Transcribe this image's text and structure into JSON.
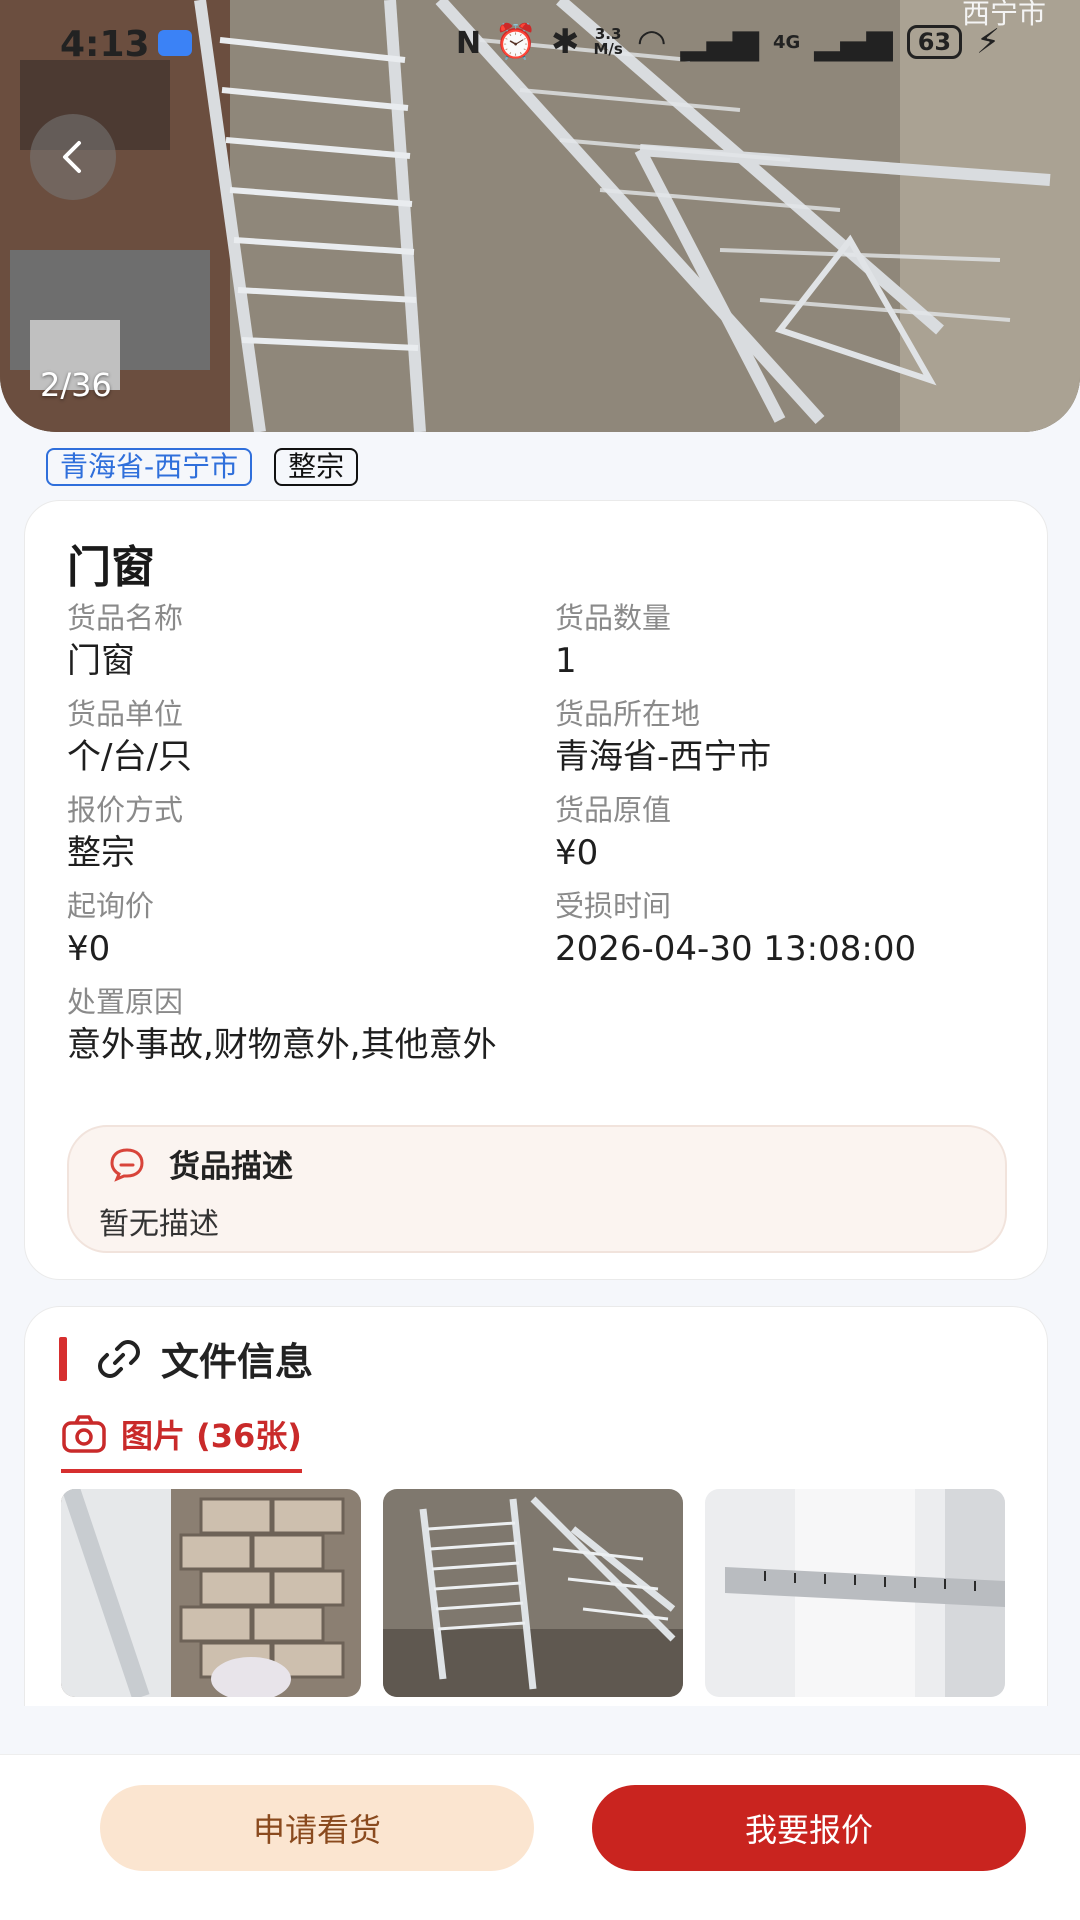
{
  "status_bar": {
    "time": "4:13",
    "speed_value": "3.3",
    "speed_unit": "M/s",
    "network": "4G",
    "battery": "63"
  },
  "hero": {
    "overlay_city": "西宁市",
    "counter": "2/36",
    "icons": {
      "back": "chevron-left-icon"
    }
  },
  "tags": [
    "青海省-西宁市",
    "整宗"
  ],
  "item": {
    "title": "门窗",
    "fields": [
      {
        "label": "货品名称",
        "value": "门窗"
      },
      {
        "label": "货品数量",
        "value": "1"
      },
      {
        "label": "货品单位",
        "value": "个/台/只"
      },
      {
        "label": "货品所在地",
        "value": "青海省-西宁市"
      },
      {
        "label": "报价方式",
        "value": "整宗"
      },
      {
        "label": "货品原值",
        "value": "¥0"
      },
      {
        "label": "起询价",
        "value": "¥0"
      },
      {
        "label": "受损时间",
        "value": "2026-04-30 13:08:00"
      },
      {
        "label": "处置原因",
        "value": "意外事故,财物意外,其他意外"
      }
    ],
    "description": {
      "title": "货品描述",
      "text": "暂无描述",
      "icon": "chat-bubble-icon"
    }
  },
  "files": {
    "title": "文件信息",
    "icon": "link-icon",
    "photos_tab": "图片 (36张)",
    "photos_icon": "camera-icon",
    "thumbnail_count": 3
  },
  "actions": {
    "view": "申请看货",
    "quote": "我要报价"
  },
  "colors": {
    "accent": "#c9241f",
    "tag_blue": "#2f6fdb",
    "view_button_bg": "#fbe5d0"
  }
}
